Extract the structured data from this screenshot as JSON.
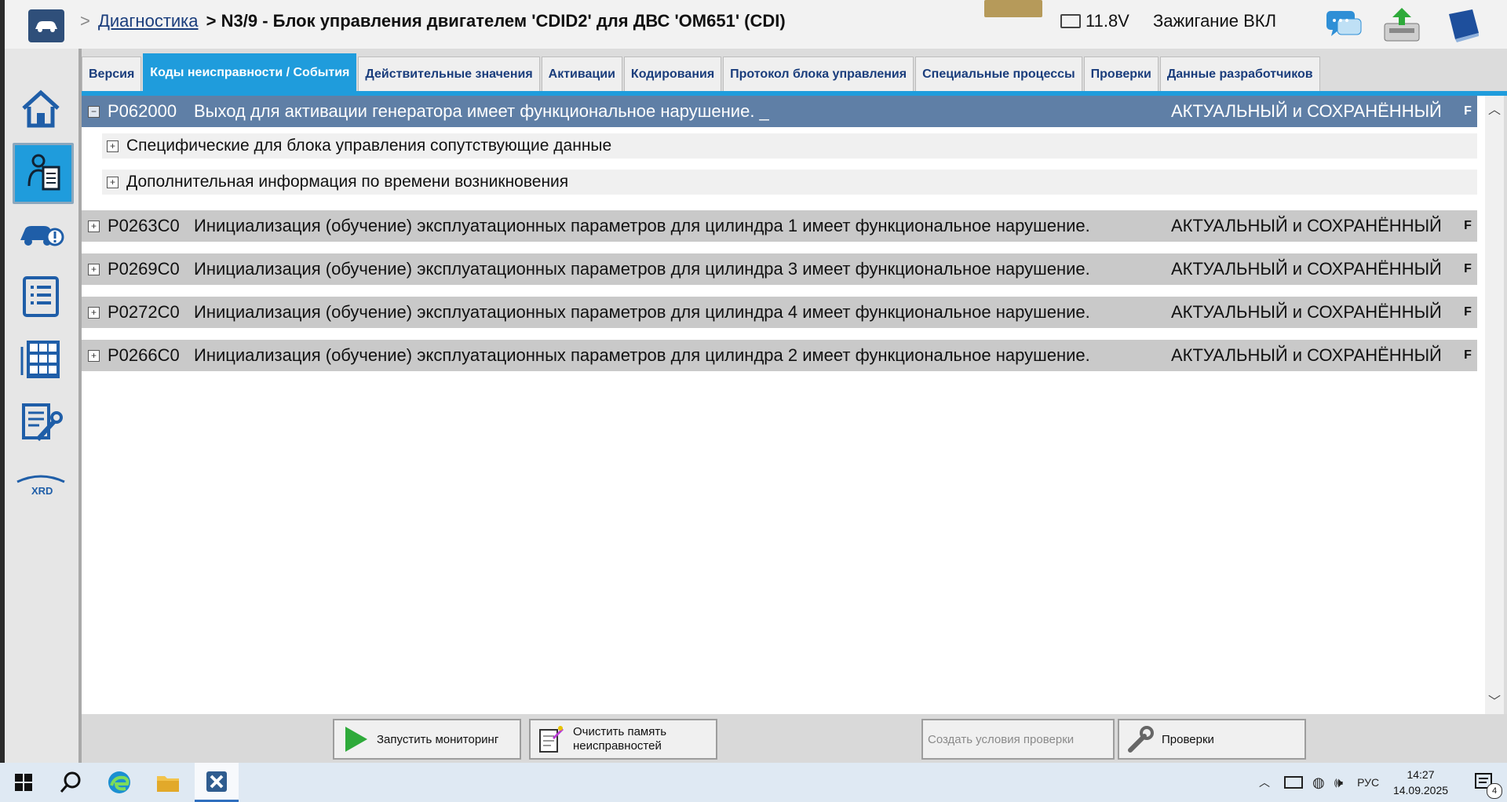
{
  "header": {
    "breadcrumb_sep": ">",
    "breadcrumb_link": "Диагностика",
    "breadcrumb_current": "> N3/9 - Блок управления двигателем 'CDID2' для ДВС 'OM651' (CDI)",
    "voltage": "11.8V",
    "ignition": "Зажигание ВКЛ"
  },
  "leftnav": [
    {
      "name": "home-icon"
    },
    {
      "name": "diagnostics-icon",
      "active": true
    },
    {
      "name": "vehicle-alert-icon"
    },
    {
      "name": "list-icon"
    },
    {
      "name": "modules-grid-icon"
    },
    {
      "name": "document-wrench-icon"
    },
    {
      "name": "xrd-logo-icon",
      "label": "XRD"
    }
  ],
  "tabs": [
    {
      "label": "Версия"
    },
    {
      "label": "Коды неисправности / События",
      "active": true
    },
    {
      "label": "Действительные значения"
    },
    {
      "label": "Активации"
    },
    {
      "label": "Кодирования"
    },
    {
      "label": "Протокол блока управления"
    },
    {
      "label": "Специальные процессы"
    },
    {
      "label": "Проверки"
    },
    {
      "label": "Данные разработчиков"
    }
  ],
  "faults": [
    {
      "code": "P062000",
      "description": "Выход для активации генератора имеет функциональное нарушение. _",
      "status": "АКТУАЛЬНЫЙ и СОХРАНЁННЫЙ",
      "flag": "F",
      "expanded": true,
      "subrows": [
        "Специфические для блока управления сопутствующие данные",
        "Дополнительная информация по времени возникновения"
      ]
    },
    {
      "code": "P0263C0",
      "description": "Инициализация (обучение) эксплуатационных параметров для цилиндра 1 имеет функциональное нарушение.",
      "status": "АКТУАЛЬНЫЙ и СОХРАНЁННЫЙ",
      "flag": "F"
    },
    {
      "code": "P0269C0",
      "description": "Инициализация (обучение) эксплуатационных параметров для цилиндра 3 имеет функциональное нарушение.",
      "status": "АКТУАЛЬНЫЙ и СОХРАНЁННЫЙ",
      "flag": "F"
    },
    {
      "code": "P0272C0",
      "description": "Инициализация (обучение) эксплуатационных параметров для цилиндра 4 имеет функциональное нарушение.",
      "status": "АКТУАЛЬНЫЙ и СОХРАНЁННЫЙ",
      "flag": "F"
    },
    {
      "code": "P0266C0",
      "description": "Инициализация (обучение) эксплуатационных параметров для цилиндра 2 имеет функциональное нарушение.",
      "status": "АКТУАЛЬНЫЙ и СОХРАНЁННЫЙ",
      "flag": "F"
    }
  ],
  "bottom": {
    "start_monitoring": "Запустить мониторинг",
    "clear_memory_line1": "Очистить память",
    "clear_memory_line2": "неисправностей",
    "create_conditions": "Создать условия проверки",
    "tests": "Проверки"
  },
  "taskbar": {
    "language": "РУС",
    "time": "14:27",
    "date": "14.09.2025",
    "notifications": "4"
  }
}
